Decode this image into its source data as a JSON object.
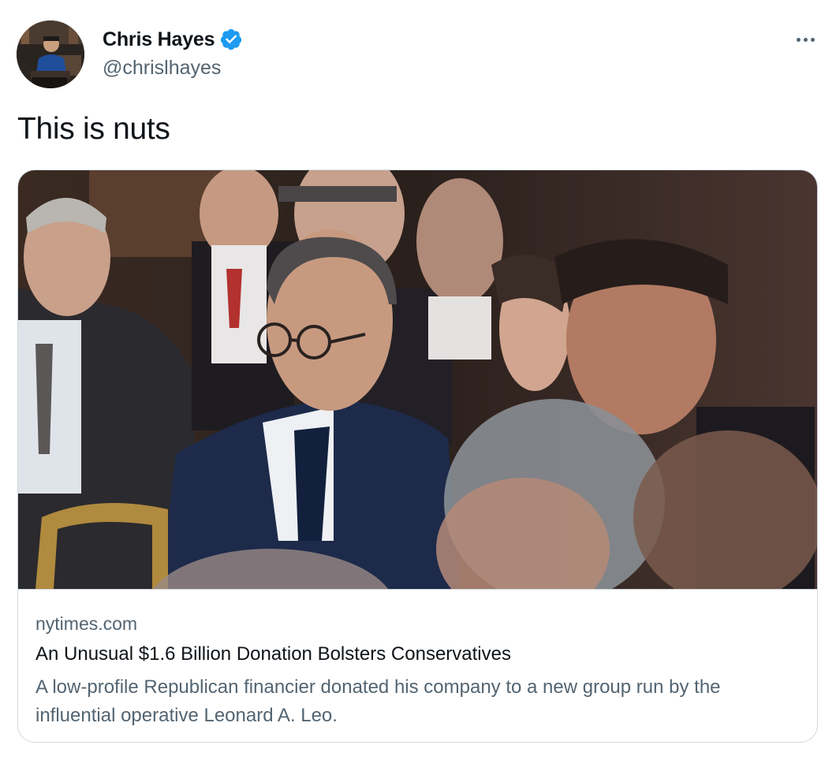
{
  "author": {
    "name": "Chris Hayes",
    "handle": "@chrislhayes",
    "verified": true,
    "avatar_icon": "profile-avatar"
  },
  "tweet": {
    "text": "This is nuts",
    "more_icon": "ellipsis-icon"
  },
  "link_card": {
    "image_icon": "news-photo",
    "domain": "nytimes.com",
    "title": "An Unusual $1.6 Billion Donation Bolsters Conservatives",
    "description": "A low-profile Republican financier donated his company to a new group run by the influential operative Leonard A. Leo."
  },
  "colors": {
    "verified_blue": "#1d9bf0",
    "secondary_text": "#536471",
    "primary_text": "#0f1419",
    "border": "#cfd9de"
  }
}
